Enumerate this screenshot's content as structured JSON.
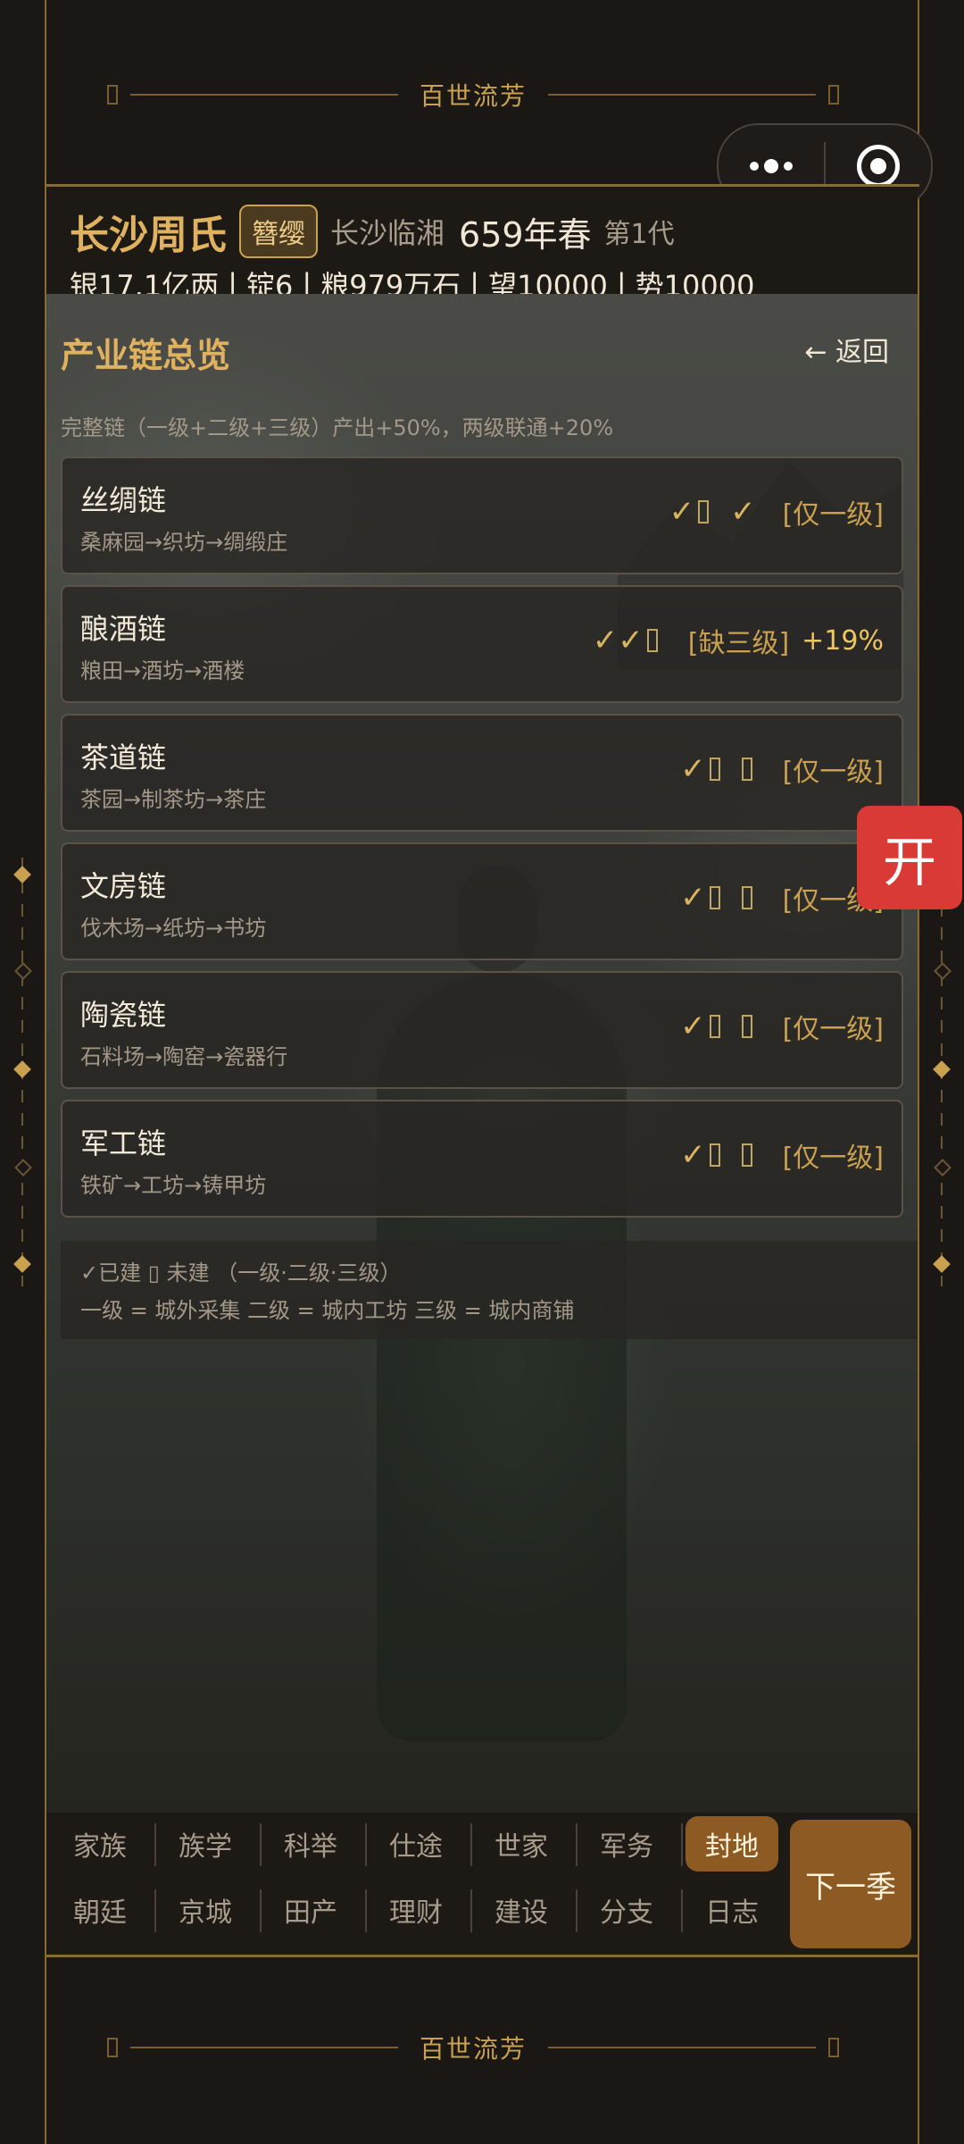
{
  "banner": {
    "text": "百世流芳"
  },
  "capsule": {
    "more_icon": "more-dots-icon",
    "close_icon": "target-circle-icon"
  },
  "header": {
    "family_name": "长沙周氏",
    "rank_badge": "簪缨",
    "region": "长沙临湘",
    "year": "659年春",
    "generation": "第1代",
    "resources": {
      "silver": "银17.1亿两",
      "ingot": "锭6",
      "grain": "粮979万石",
      "prestige": "望10000",
      "power": "势10000",
      "separator": "|"
    }
  },
  "panel": {
    "title": "产业链总览",
    "back_label": "← 返回",
    "summary_note": "完整链（一级+二级+三级）产出+50%，两级联通+20%"
  },
  "chains": [
    {
      "name": "丝绸链",
      "steps": "桑麻园→织坊→绸缎庄",
      "status_tag": "[仅一级]",
      "bonus": ""
    },
    {
      "name": "酿酒链",
      "steps": "粮田→酒坊→酒楼",
      "status_tag": "[缺三级]",
      "bonus": "+19%"
    },
    {
      "name": "茶道链",
      "steps": "茶园→制茶坊→茶庄",
      "status_tag": "[仅一级]",
      "bonus": ""
    },
    {
      "name": "文房链",
      "steps": "伐木场→纸坊→书坊",
      "status_tag": "[仅一级]",
      "bonus": ""
    },
    {
      "name": "陶瓷链",
      "steps": "石料场→陶窑→瓷器行",
      "status_tag": "[仅一级]",
      "bonus": ""
    },
    {
      "name": "军工链",
      "steps": "铁矿→工坊→铸甲坊",
      "status_tag": "[仅一级]",
      "bonus": ""
    }
  ],
  "legend": {
    "line1": "✓已建 ▯ 未建 （一级·二级·三级）",
    "line2": "一级 = 城外采集  二级 = 城内工坊  三级 = 城内商铺"
  },
  "tabs": {
    "row1": [
      "家族",
      "族学",
      "科举",
      "仕途",
      "世家",
      "军务",
      "封地"
    ],
    "row2": [
      "朝廷",
      "京城",
      "田产",
      "理财",
      "建设",
      "分支",
      "日志"
    ],
    "active": "封地",
    "next_season": "下一季"
  },
  "float_button": {
    "label": "开",
    "color": "#d93a35"
  },
  "colors": {
    "accent_gold": "#c9a14f",
    "active_tab": "#8d5a24"
  }
}
